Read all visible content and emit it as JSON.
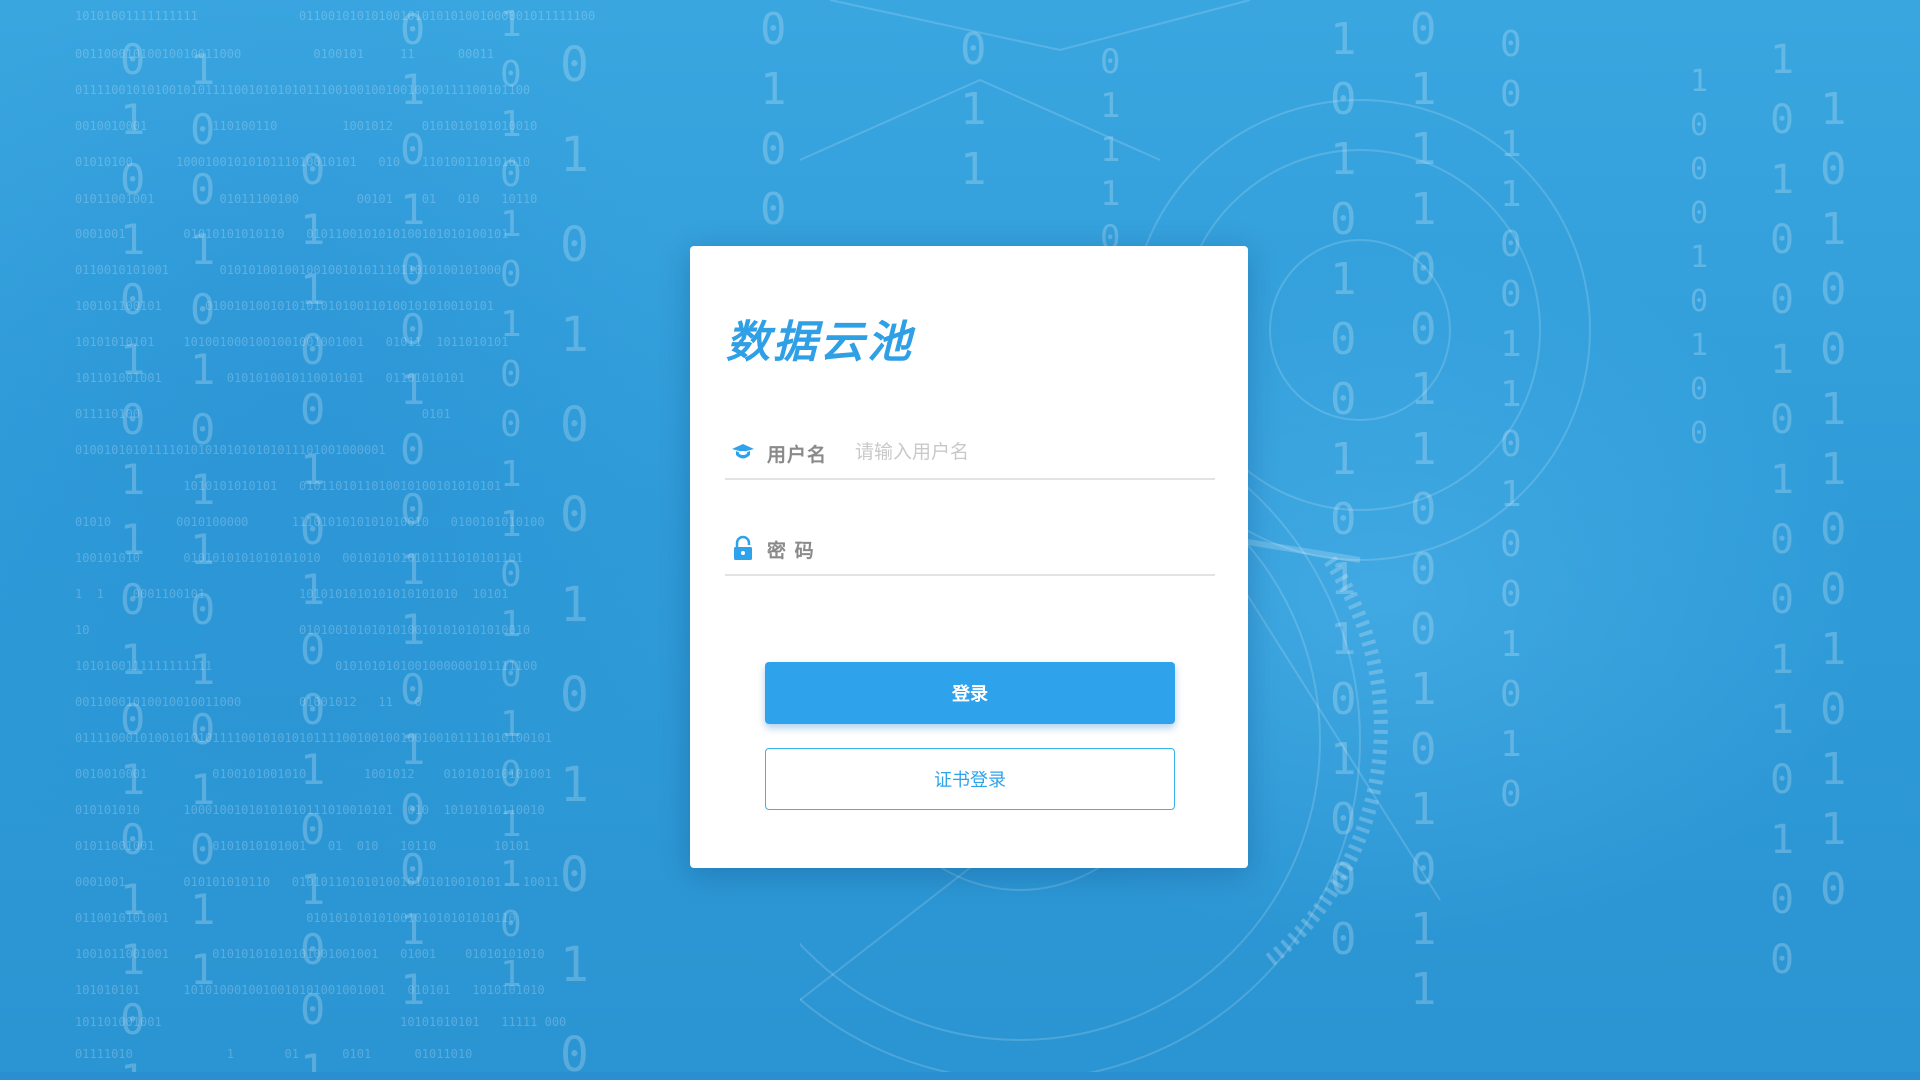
{
  "brand": {
    "title": "数据云池"
  },
  "login_form": {
    "username": {
      "icon": "user-icon",
      "label": "用户名",
      "placeholder": "请输入用户名",
      "value": ""
    },
    "password": {
      "icon": "lock-icon",
      "label": "密 码",
      "placeholder": "",
      "value": ""
    },
    "login_button_label": "登录",
    "cert_login_button_label": "证书登录"
  },
  "colors": {
    "accent": "#2fa2ec",
    "background": "#3aa6e0",
    "cert_border": "#35b5e8"
  }
}
